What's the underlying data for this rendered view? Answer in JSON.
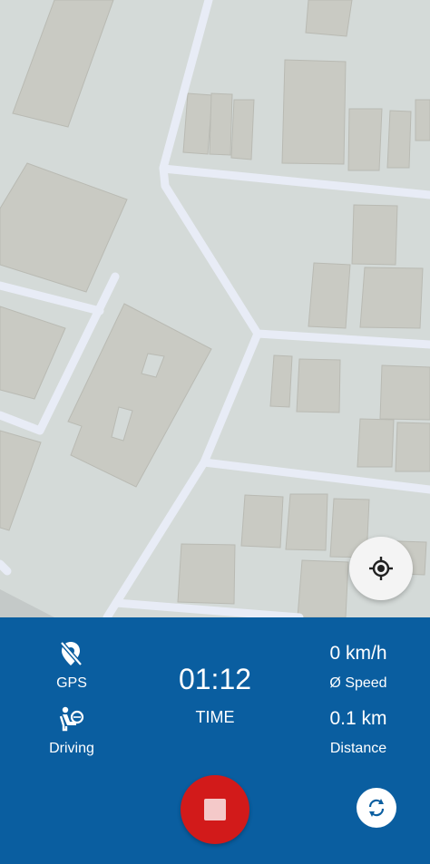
{
  "colors": {
    "map_background": "#d4dad8",
    "building": "#c9cac3",
    "road": "#e8ecf6",
    "panel": "#0a5ea0",
    "record_button": "#d21a1a"
  },
  "icons": {
    "gps": "location-off-icon",
    "driving": "driving-icon",
    "locate": "my-location-icon",
    "record": "stop-icon",
    "switch": "switch-view-icon"
  },
  "panel": {
    "gps_label": "GPS",
    "mode_label": "Driving",
    "timer_value": "01:12",
    "timer_label": "TIME",
    "speed_value": "0 km/h",
    "speed_label": "Ø Speed",
    "distance_value": "0.1 km",
    "distance_label": "Distance"
  }
}
